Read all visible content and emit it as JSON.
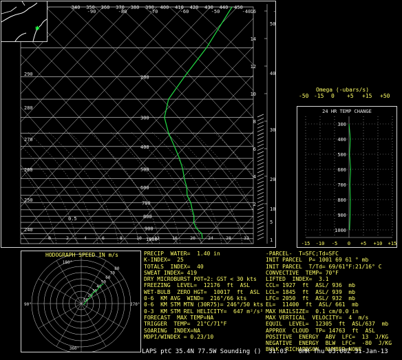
{
  "chart_data": {
    "type": "skew-t sounding",
    "footer": "LAPS ptC 35.4N 77.5W Sounding ()  31.03   0HR Thu 03:00Z 31-Jan-13",
    "skewt": {
      "top_temps_c": [
        "-90",
        "-80",
        "-70",
        "-60",
        "-50",
        "-40",
        "-30"
      ],
      "top_temps_k": [
        "340",
        "350",
        "360",
        "370",
        "380",
        "390",
        "400",
        "410",
        "420",
        "430",
        "440",
        "450"
      ],
      "left_labels": [
        "290",
        "280",
        "270",
        "260",
        "250",
        "240",
        "230"
      ],
      "left_label_value_ref": "0.5",
      "pressure_labels_mb": [
        "200",
        "300",
        "400",
        "500",
        "600",
        "700",
        "800",
        "900",
        "1000"
      ],
      "height_km": [
        "16",
        "14",
        "12",
        "10",
        "8",
        "6",
        "4",
        "2"
      ],
      "height_kft": [
        "50",
        "40",
        "30",
        "20",
        "10",
        "5",
        "1"
      ],
      "wet_bulb_labels": [
        "0",
        "2",
        "4",
        "6",
        "8",
        "10",
        "12",
        "16",
        "20",
        "24",
        "28",
        "32"
      ],
      "temperature_profile": [
        {
          "p": 1000,
          "t": 9
        },
        {
          "p": 950,
          "t": 7
        },
        {
          "p": 925,
          "t": 5
        },
        {
          "p": 900,
          "t": 3
        },
        {
          "p": 850,
          "t": 0
        },
        {
          "p": 800,
          "t": -2
        },
        {
          "p": 750,
          "t": -5
        },
        {
          "p": 700,
          "t": -8
        },
        {
          "p": 650,
          "t": -12
        },
        {
          "p": 600,
          "t": -15
        },
        {
          "p": 550,
          "t": -19
        },
        {
          "p": 500,
          "t": -23
        },
        {
          "p": 450,
          "t": -28
        },
        {
          "p": 400,
          "t": -34
        },
        {
          "p": 350,
          "t": -41
        },
        {
          "p": 300,
          "t": -48
        },
        {
          "p": 250,
          "t": -53
        },
        {
          "p": 200,
          "t": -55
        },
        {
          "p": 150,
          "t": -57
        },
        {
          "p": 100,
          "t": -62
        }
      ]
    },
    "temp_change": {
      "title": "24 HR TEMP CHANGE",
      "omega_title": "Omega (-ubars/s)",
      "omega_ticks": [
        "-50",
        "-15",
        "0",
        "+5",
        "+15",
        "+50"
      ],
      "xticks": [
        "-15",
        "-10",
        "-5",
        "0",
        "+5",
        "+10",
        "+15"
      ],
      "xlim": [
        -15,
        15
      ],
      "pressure_labels": [
        "300",
        "400",
        "500",
        "600",
        "700",
        "800",
        "900",
        "1000"
      ],
      "profile": [
        {
          "p": 300,
          "v": 0
        },
        {
          "p": 400,
          "v": 0.5
        },
        {
          "p": 500,
          "v": 0.2
        },
        {
          "p": 600,
          "v": 0.6
        },
        {
          "p": 700,
          "v": 0.3
        },
        {
          "p": 800,
          "v": 0.5
        },
        {
          "p": 900,
          "v": 0.4
        },
        {
          "p": 1000,
          "v": 0.2
        }
      ]
    },
    "hodograph": {
      "title": "HODOGRAPH SPEED IN m/s",
      "ring_labels": [
        "10",
        "20",
        "30",
        "40",
        "50",
        "60",
        "70",
        "80"
      ],
      "direction_labels": [
        "180°",
        "270°",
        "90°",
        "360°"
      ],
      "wind_profile": [
        {
          "u": 2,
          "v": -1
        },
        {
          "u": 4,
          "v": 2
        },
        {
          "u": 7,
          "v": 5
        },
        {
          "u": 10,
          "v": 9
        },
        {
          "u": 13,
          "v": 11
        },
        {
          "u": 15,
          "v": 14
        },
        {
          "u": 18,
          "v": 16
        }
      ]
    }
  },
  "indices_left": [
    "PRECIP  WATER=  1.40 in",
    "K-INDEX=  25",
    "TOTALS  INDEX=  40",
    "SWEAT INDEX= 419",
    "DRY MICROBURST POT=2: GST < 30 kts",
    "FREEZING  LEVEL=  12176  ft  ASL",
    "WET-BULB  ZERO HGT=  10017  ft  ASL",
    "0-6  KM AVG  WIND=  216°/66 kts",
    "0-6  KM STM MTN (30R75)= 246°/50 kts",
    "0-3  KM STM REL HELICITY=  647 m²/s²",
    "FORECAST  MAX TEMP=NA",
    "TRIGGER  TEMP=  21°C/71°F",
    "SOARING  INDEX=NA",
    "MDPI/WINDEX = 0.23/10"
  ],
  "indices_right": [
    "-PARCEL-  T=SFC;Td=SFC",
    "INIT PARCEL  P= 1001 69 61 ° mb",
    "INIT PARCEL  T/Td= 69/61°F:21/16° C",
    "CONVECTIVE  TEMP= 70°F",
    "LIFTED  INDEX=  3.1",
    "CCL= 1927  ft  ASL/ 936  mb",
    "LCL= 1845  ft  ASL/ 939  mb",
    "LFC= 2050  ft  ASL/ 932  mb",
    "EL=  11400  ft  ASL/ 661  mb",
    "MAX HAILSIZE=  0.1 cm/0.0 in",
    "MAX VERTICAL  VELOCITY=  4  m/s",
    "EQUIL  LEVEL=  12305  ft  ASL/637  mb",
    "APPROX  CLOUD  TP= 14763  ft  ASL",
    "POSITIVE  ENERGY  ABV  LFC=  13  J/KG",
    "NEGATIVE  ENERGY  BLW  LFC=  -80  J/KG",
    "BULK  RICHARDSON  NUMBER=NONE"
  ],
  "colors": {
    "temp_line": "#22dd44",
    "grid": "#e0e0e0",
    "text": "#ffff66",
    "map_marker": "#22ff44"
  }
}
